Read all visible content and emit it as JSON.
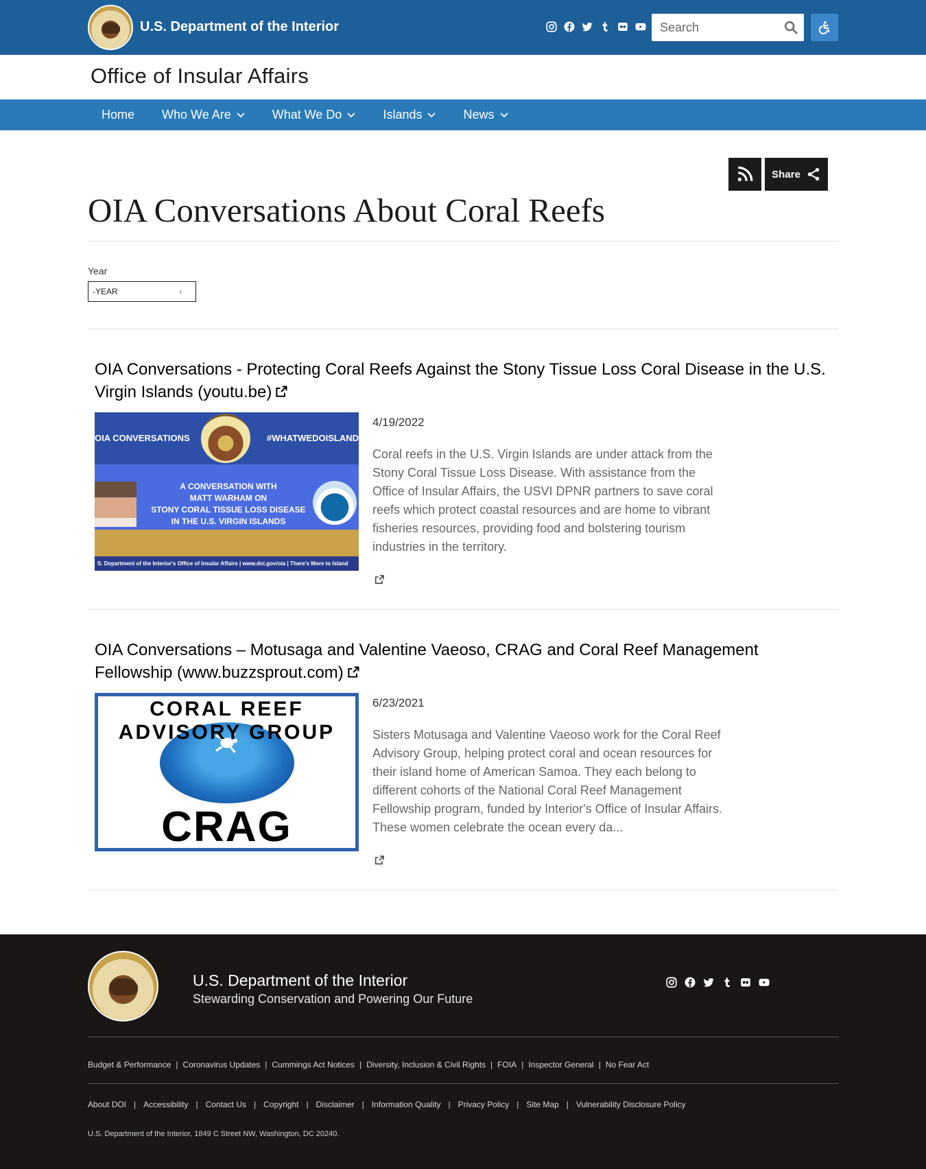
{
  "header": {
    "brand": "U.S. Department of the Interior",
    "search_placeholder": "Search",
    "social_icons": [
      "instagram-icon",
      "facebook-icon",
      "twitter-icon",
      "tumblr-icon",
      "flickr-icon",
      "youtube-icon"
    ]
  },
  "office_title": "Office of Insular Affairs",
  "nav": {
    "items": [
      {
        "label": "Home"
      },
      {
        "label": "Who We Are"
      },
      {
        "label": "What We Do"
      },
      {
        "label": "Islands"
      },
      {
        "label": "News"
      }
    ]
  },
  "actions": {
    "share_label": "Share"
  },
  "page_title": "OIA Conversations About Coral Reefs",
  "filter": {
    "label": "Year",
    "selected": "-YEAR"
  },
  "articles": [
    {
      "title": "OIA Conversations - Protecting Coral Reefs Against the Stony Tissue Loss Coral Disease in the U.S. Virgin Islands (youtu.be)",
      "date": "4/19/2022",
      "body": "Coral reefs in the U.S. Virgin Islands are under attack from the Stony Coral Tissue Loss Disease. With assistance from the Office of Insular Affairs, the USVI DPNR partners to save coral reefs which protect coastal resources and are home to vibrant fisheries resources, providing food and bolstering tourism industries in the territory.",
      "thumb": {
        "left_text": "OIA CONVERSATIONS",
        "right_text": "#WHATWEDOISLAND",
        "mid_line1": "A CONVERSATION WITH",
        "mid_line2": "MATT WARHAM ON",
        "mid_line3": "STONY CORAL TISSUE LOSS DISEASE",
        "mid_line4": "IN THE U.S. VIRGIN ISLANDS",
        "footer": "S. Department of the Interior's Office of Insular Affairs | www.doi.gov/oia | There's More to Island"
      }
    },
    {
      "title": "OIA Conversations – Motusaga and Valentine Vaeoso, CRAG and Coral Reef Management Fellowship (www.buzzsprout.com)",
      "date": "6/23/2021",
      "body": "Sisters Motusaga and Valentine Vaeoso work for the Coral Reef Advisory Group, helping protect coral and ocean resources for their island home of American Samoa. They each belong to different cohorts of the National Coral Reef Management Fellowship program, funded by Interior's Office of Insular Affairs. These women celebrate the ocean every da...",
      "thumb": {
        "arc_text": "CORAL REEF ADVISORY GROUP",
        "word": "CRAG"
      }
    }
  ],
  "footer": {
    "name": "U.S. Department of the Interior",
    "tagline": "Stewarding Conservation and Powering Our Future",
    "links_row1": [
      "Budget & Performance",
      "Coronavirus Updates",
      "Cummings Act Notices",
      "Diversity, Inclusion & Civil Rights",
      "FOIA",
      "Inspector General",
      "No Fear Act"
    ],
    "links_row2": [
      "About DOI",
      "Accessibility",
      "Contact Us",
      "Copyright",
      "Disclaimer",
      "Information Quality",
      "Privacy Policy",
      "Site Map",
      "Vulnerability Disclosure Policy"
    ],
    "address": "U.S. Department of the Interior, 1849 C Street NW, Washington, DC 20240."
  },
  "colors": {
    "header_blue": "#1d5f99",
    "nav_blue": "#2a7ab8",
    "accessibility_blue": "#3a86c8",
    "footer_bg": "#1b1616"
  }
}
